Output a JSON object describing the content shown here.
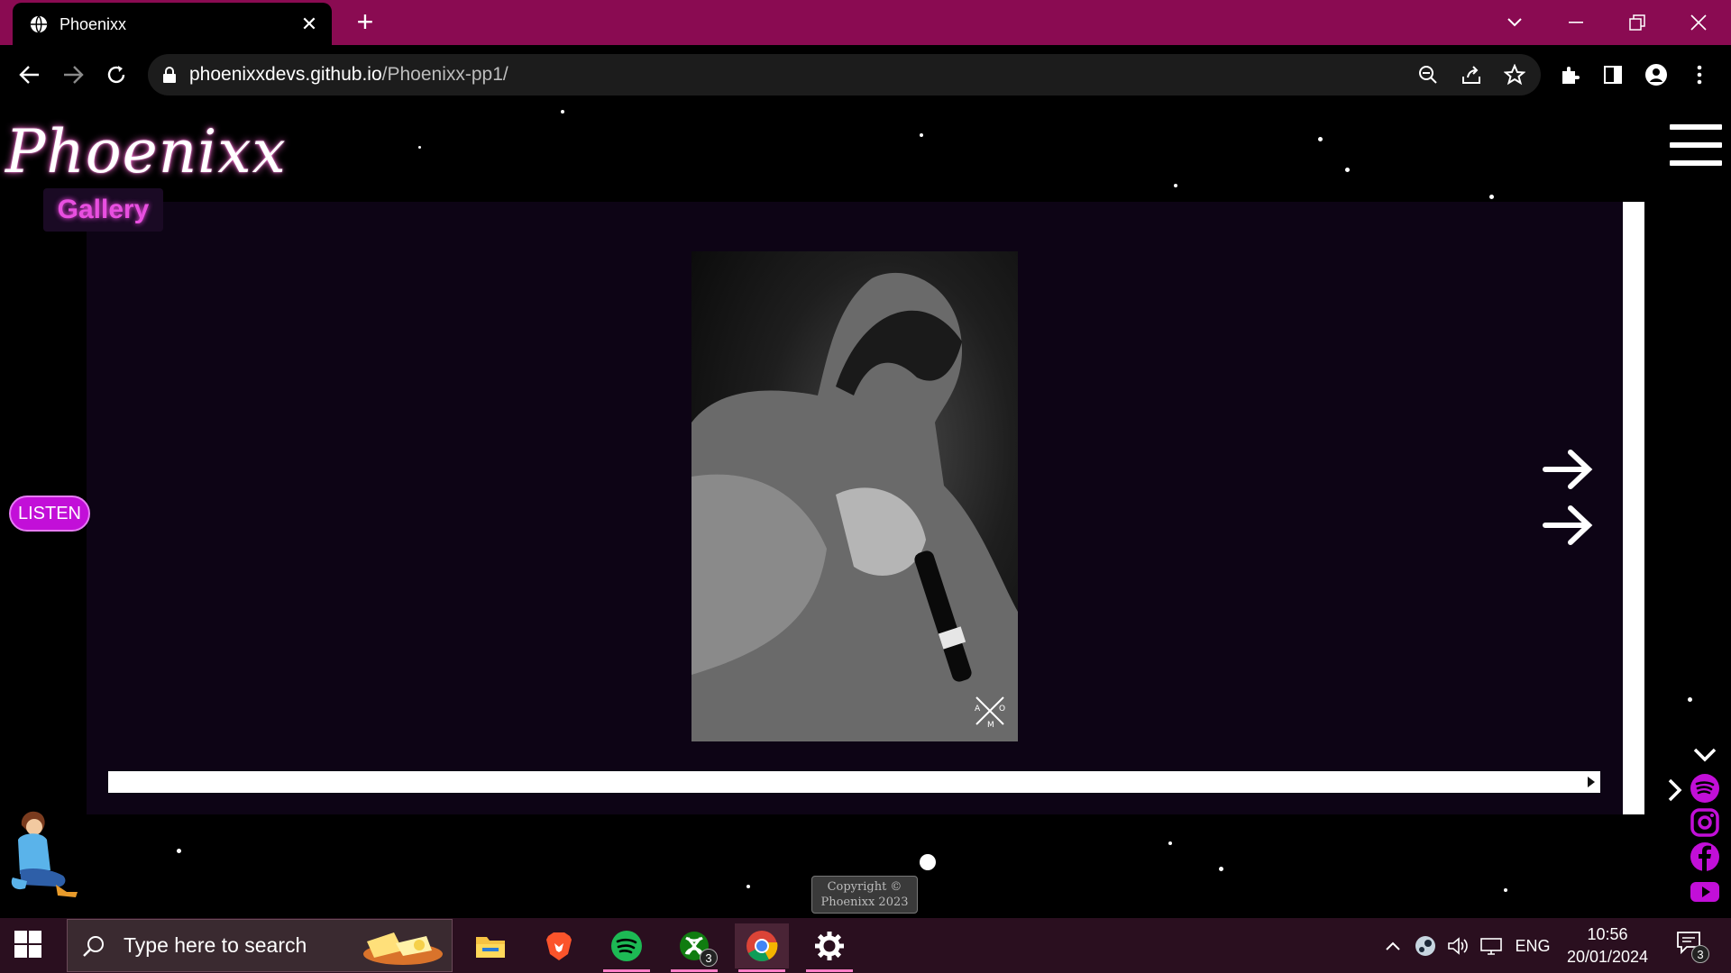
{
  "browser": {
    "tab_title": "Phoenixx",
    "url_host": "phoenixxdevs.github.io",
    "url_path": "/Phoenixx-pp1/"
  },
  "site": {
    "logo": "Phoenixx",
    "section_label": "Gallery",
    "listen_button": "LISTEN",
    "copyright_line1": "Copyright ©",
    "copyright_line2": "Phoenixx 2023",
    "accent_color": "#c20fd8",
    "social_icons": [
      "spotify-icon",
      "instagram-icon",
      "facebook-icon",
      "youtube-icon"
    ]
  },
  "taskbar": {
    "search_placeholder": "Type here to search",
    "xbox_badge": "3",
    "language": "ENG",
    "time": "10:56",
    "date": "20/01/2024",
    "notification_badge": "3"
  }
}
